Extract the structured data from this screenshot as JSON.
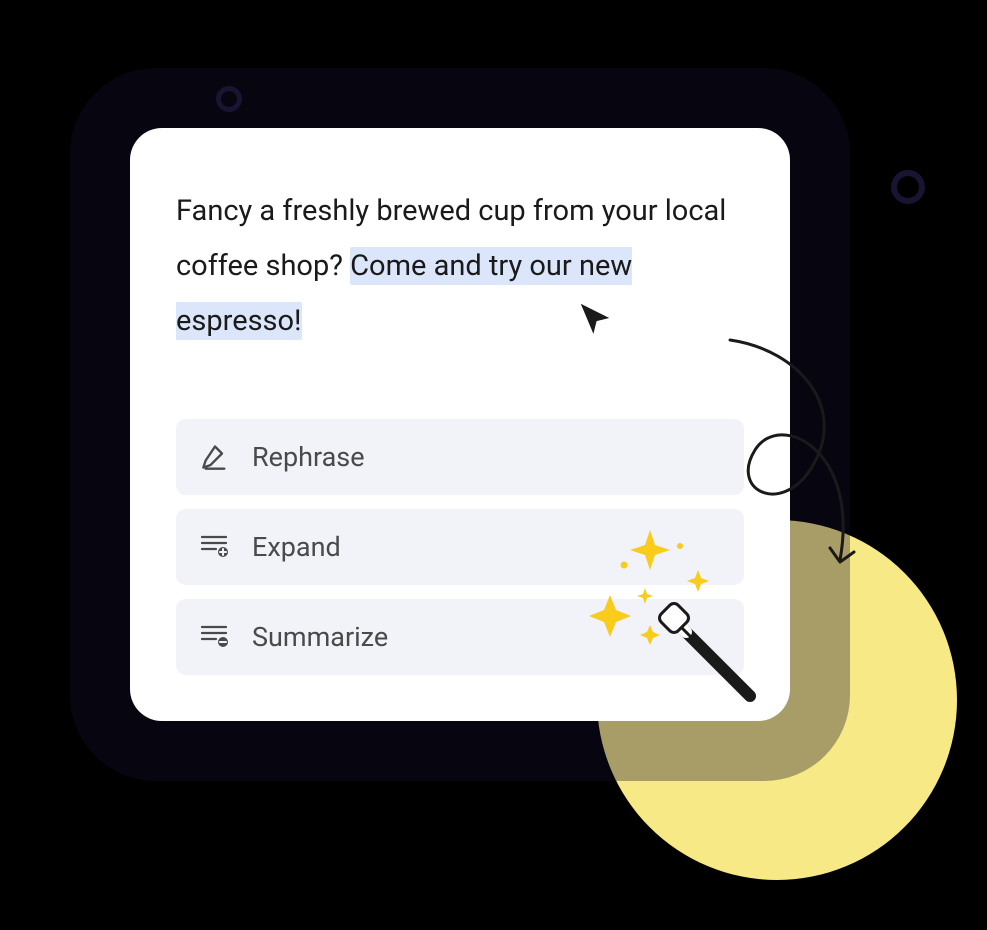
{
  "editor": {
    "text_plain": "Fancy a freshly brewed cup from your local coffee shop? ",
    "text_highlighted": "Come and try our new espresso!"
  },
  "actions": [
    {
      "label": "Rephrase",
      "icon": "rephrase-icon"
    },
    {
      "label": "Expand",
      "icon": "expand-icon"
    },
    {
      "label": "Summarize",
      "icon": "summarize-icon"
    }
  ],
  "colors": {
    "highlight": "#dbe6fb",
    "action_bg": "#f1f3f8",
    "accent_yellow": "#f7e986",
    "sparkle": "#f9cb1a"
  }
}
